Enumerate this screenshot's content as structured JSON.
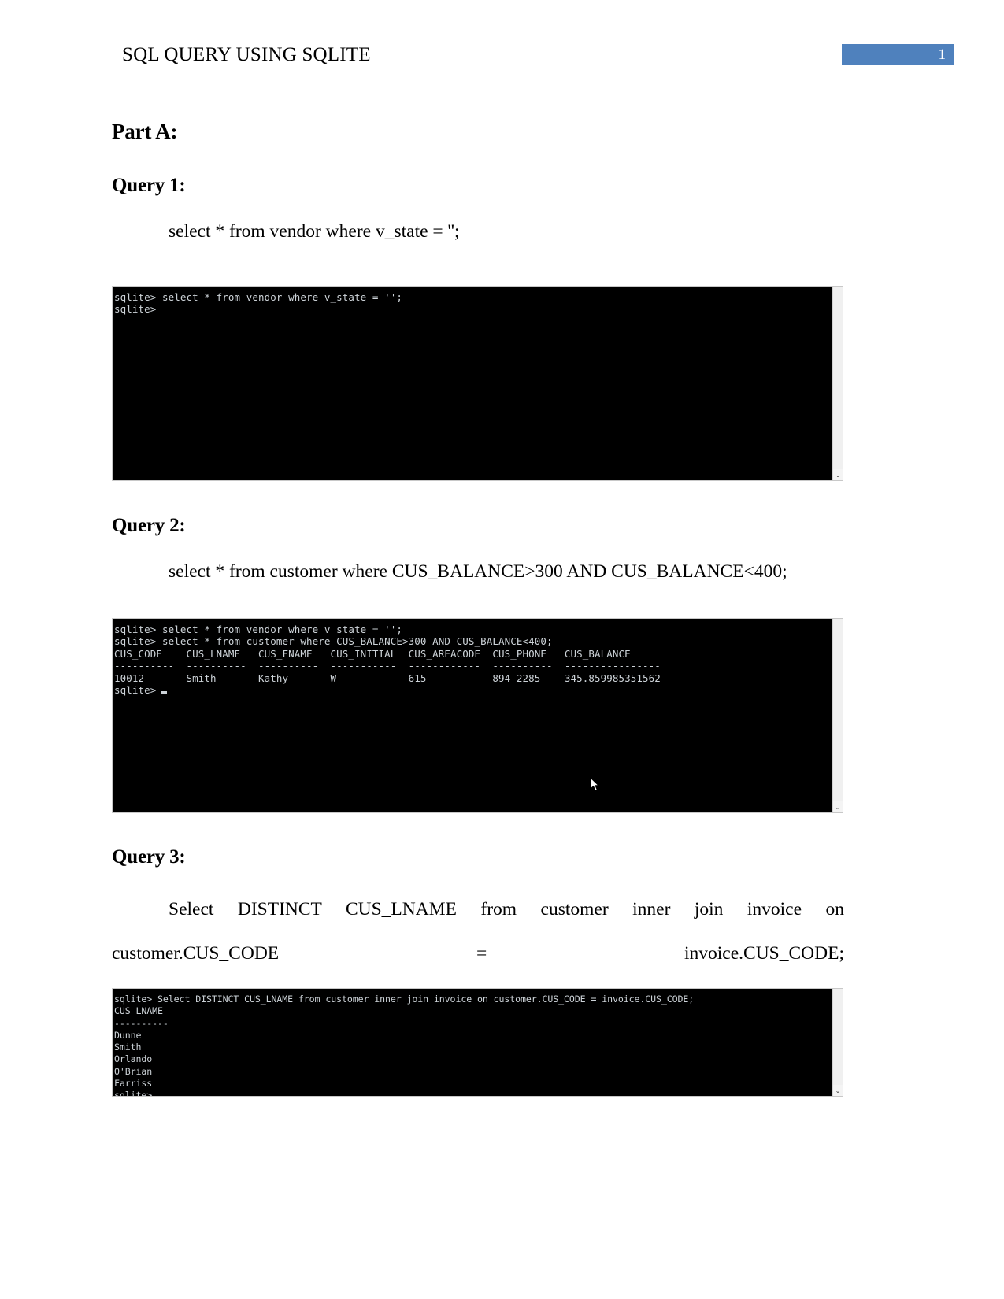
{
  "header": {
    "title": "SQL QUERY USING SQLITE",
    "page_number": "1",
    "badge_color": "#4f81bd"
  },
  "document": {
    "section_title": "Part A:",
    "queries": [
      {
        "heading": "Query 1:",
        "sql_text": "select * from vendor where v_state = '';"
      },
      {
        "heading": "Query 2:",
        "sql_text": "select * from customer where CUS_BALANCE>300 AND CUS_BALANCE<400;"
      },
      {
        "heading": "Query 3:",
        "sql_text": "Select DISTINCT CUS_LNAME from customer inner join invoice on customer.CUS_CODE = invoice.CUS_CODE;"
      }
    ]
  },
  "terminals": {
    "one": {
      "lines": "sqlite> select * from vendor where v_state = '';\nsqlite>",
      "prompt": "sqlite>"
    },
    "two": {
      "lines": "sqlite> select * from vendor where v_state = '';\nsqlite> select * from customer where CUS_BALANCE>300 AND CUS_BALANCE<400;\nCUS_CODE    CUS_LNAME   CUS_FNAME   CUS_INITIAL  CUS_AREACODE  CUS_PHONE   CUS_BALANCE\n----------  ----------  ----------  -----------  ------------  ----------  ----------------\n10012       Smith       Kathy       W            615           894-2285    345.859985351562\nsqlite>",
      "table": {
        "columns": [
          "CUS_CODE",
          "CUS_LNAME",
          "CUS_FNAME",
          "CUS_INITIAL",
          "CUS_AREACODE",
          "CUS_PHONE",
          "CUS_BALANCE"
        ],
        "rows": [
          [
            "10012",
            "Smith",
            "Kathy",
            "W",
            "615",
            "894-2285",
            "345.859985351562"
          ]
        ]
      }
    },
    "three": {
      "lines": "sqlite> Select DISTINCT CUS_LNAME from customer inner join invoice on customer.CUS_CODE = invoice.CUS_CODE;\nCUS_LNAME\n----------\nDunne\nSmith\nOrlando\nO'Brian\nFarriss\nsqlite>",
      "table": {
        "columns": [
          "CUS_LNAME"
        ],
        "rows": [
          [
            "Dunne"
          ],
          [
            "Smith"
          ],
          [
            "Orlando"
          ],
          [
            "O'Brian"
          ],
          [
            "Farriss"
          ]
        ]
      }
    }
  },
  "scrollbar": {
    "up_arrow": "⌃",
    "down_arrow": "⌄"
  }
}
